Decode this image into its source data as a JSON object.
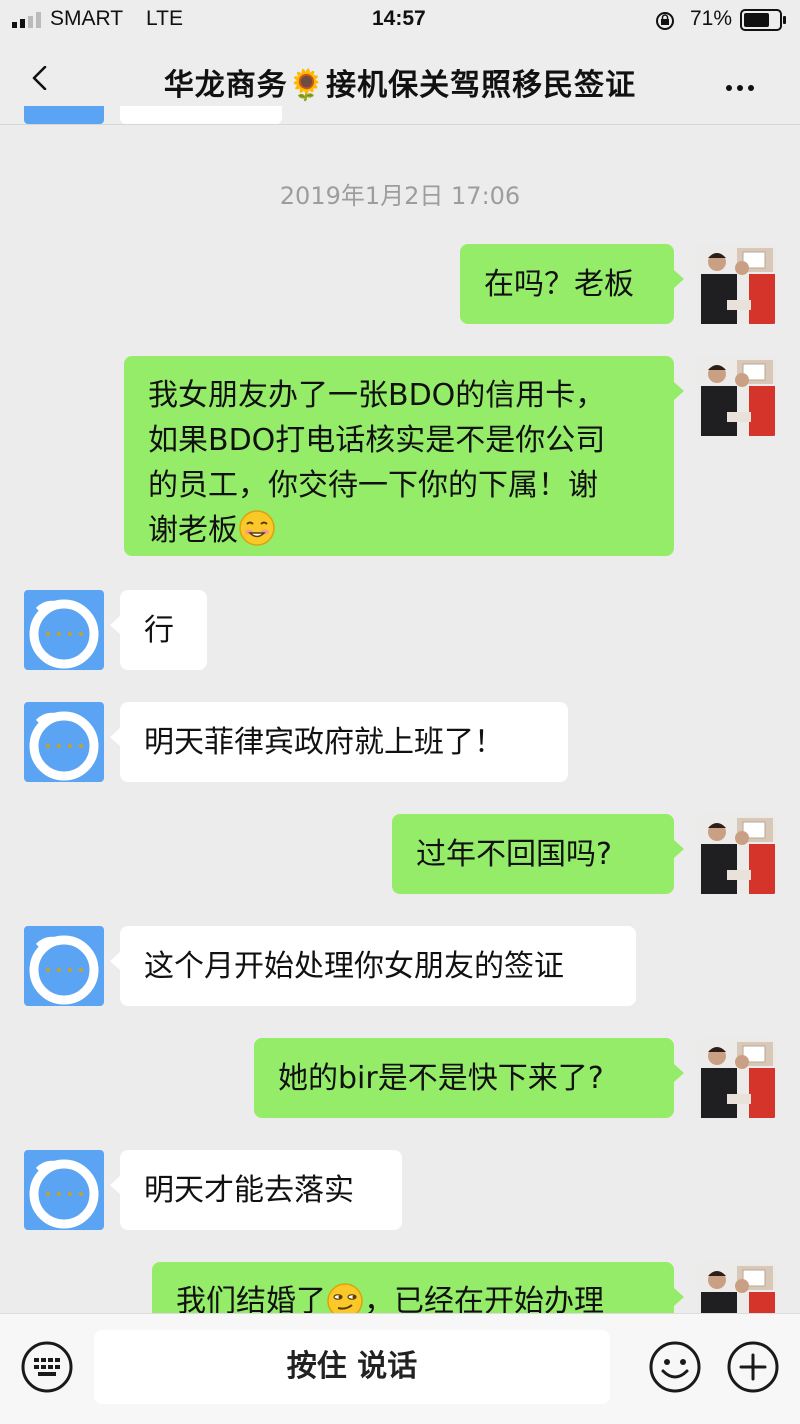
{
  "status": {
    "carrier": "SMART",
    "network": "LTE",
    "time": "14:57",
    "battery": "71%"
  },
  "header": {
    "title": "华龙商务🌻接机保关驾照移民签证"
  },
  "timestamp": "2019年1月2日 17:06",
  "messages": [
    {
      "from": "me",
      "text": "在吗？老板"
    },
    {
      "from": "me",
      "lines": [
        "我女朋友办了一张BDO的信用卡，",
        "如果BDO打电话核实是不是你公司",
        "的员工，你交待一下你的下属！谢",
        "谢老板"
      ]
    },
    {
      "from": "them",
      "text": "行"
    },
    {
      "from": "them",
      "text": "明天菲律宾政府就上班了！"
    },
    {
      "from": "me",
      "text": "过年不回国吗?"
    },
    {
      "from": "them",
      "text": "这个月开始处理你女朋友的签证"
    },
    {
      "from": "me",
      "text": "她的bir是不是快下来了?"
    },
    {
      "from": "them",
      "text": "明天才能去落实"
    },
    {
      "from": "me",
      "text_a": "我们结婚了",
      "text_b": "，已经在开始办理"
    }
  ],
  "inputbar": {
    "voice_label": "按住 说话"
  },
  "icons": [
    "back-chevron-icon",
    "more-icon",
    "keyboard-icon",
    "emoji-icon",
    "add-icon",
    "signal-icon",
    "lock-rotation-icon",
    "battery-icon"
  ]
}
